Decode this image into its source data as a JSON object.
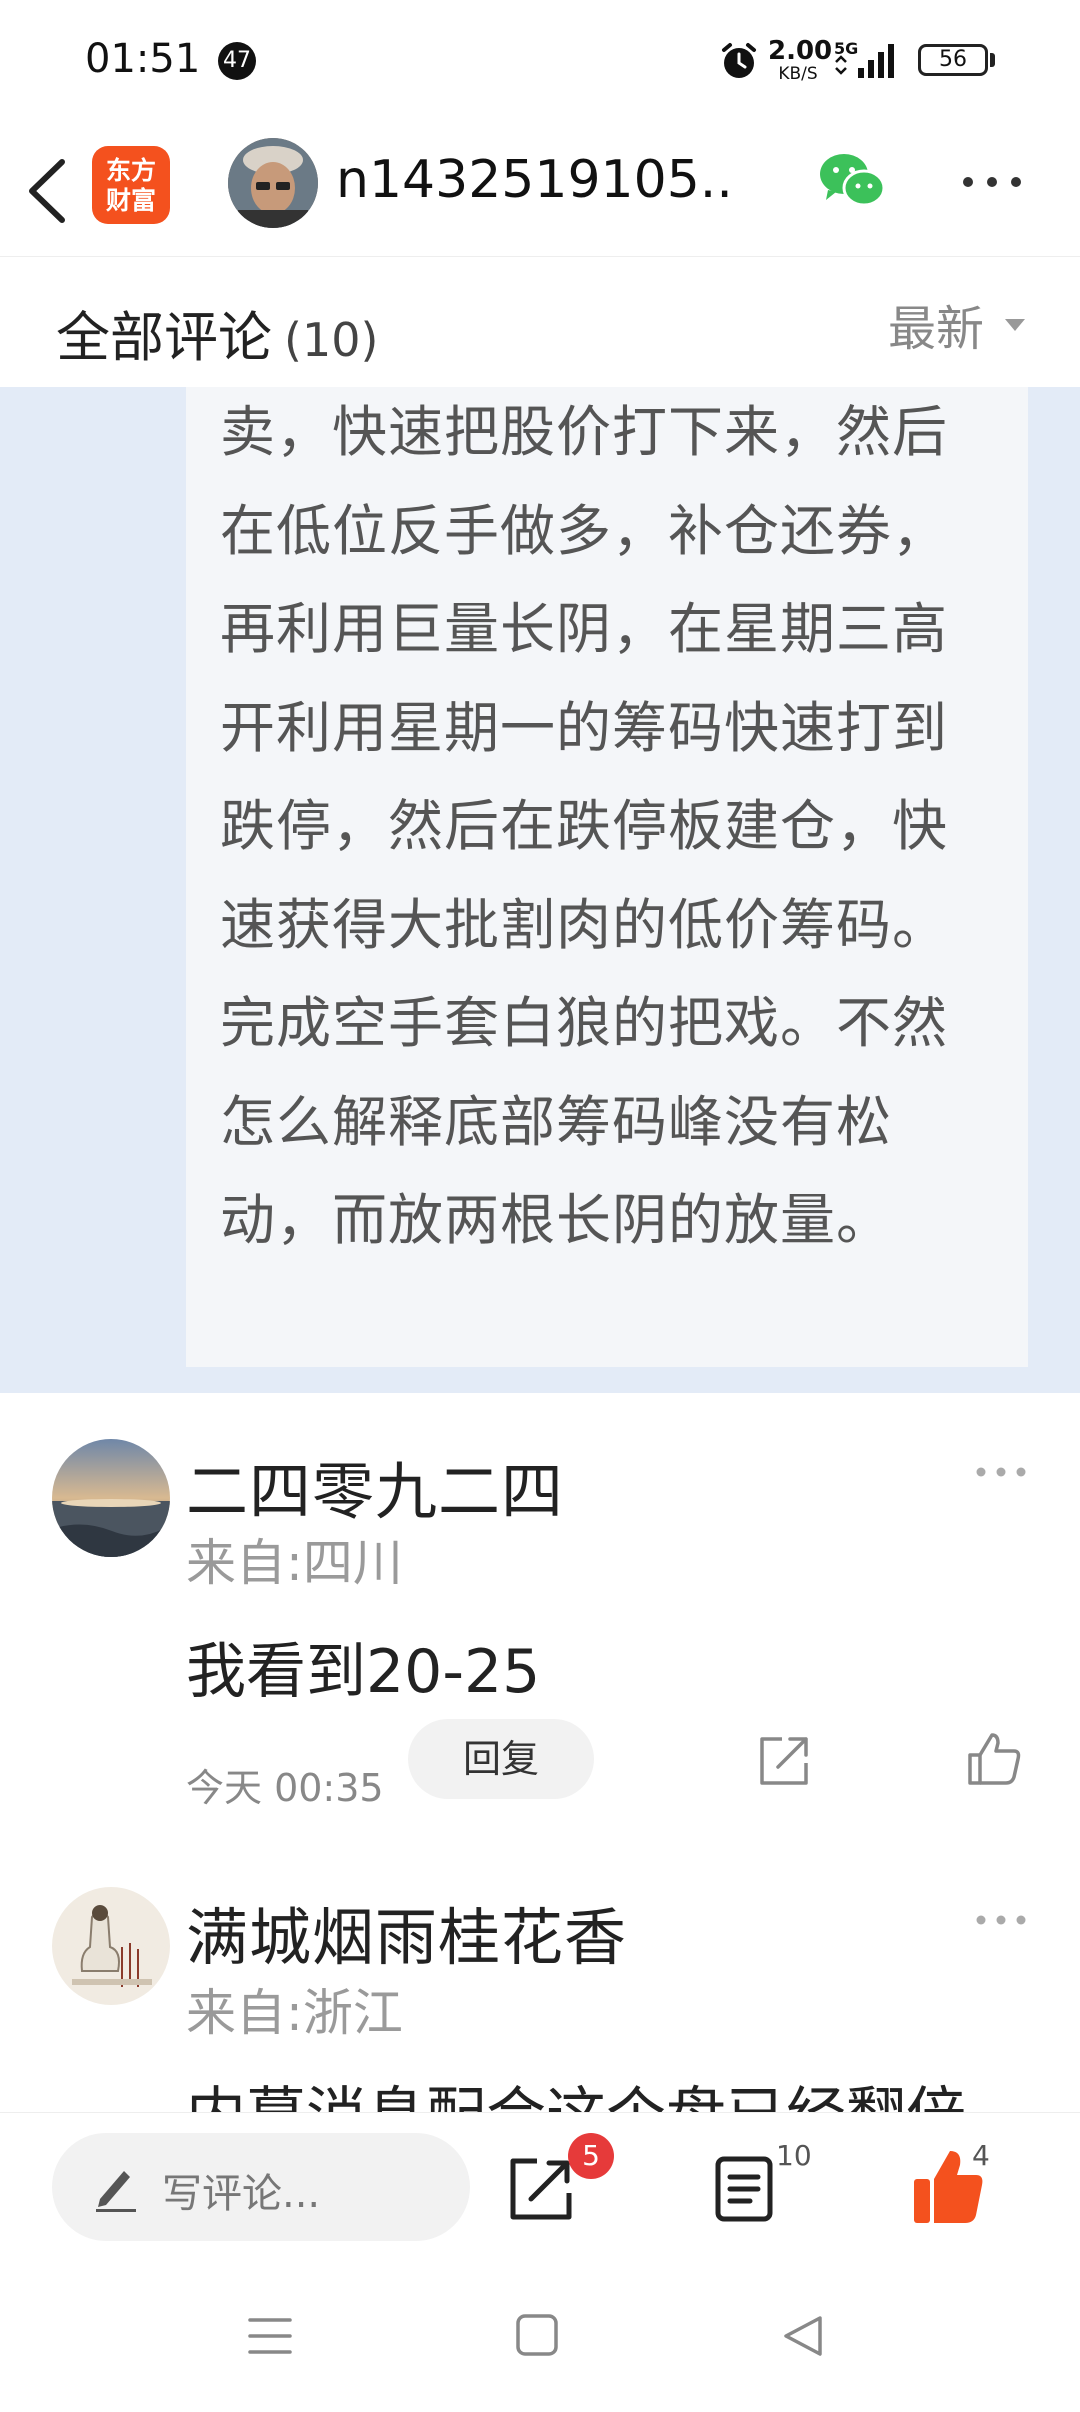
{
  "status_bar": {
    "time": "01:51",
    "notification_count": "47",
    "net_speed_value": "2.00",
    "net_speed_unit": "KB/S",
    "network_type": "5G",
    "battery": "56"
  },
  "header": {
    "app_logo_line1": "东方",
    "app_logo_line2": "财富",
    "username": "n1432519105...",
    "icons": [
      "back-icon",
      "wechat-icon",
      "more-icon"
    ]
  },
  "comments_header": {
    "title": "全部评论",
    "count": "(10)",
    "sort": "最新"
  },
  "quoted_post": {
    "text": "卖，快速把股价打下来，然后在低位反手做多，补仓还券，再利用巨量长阴，在星期三高开利用星期一的筹码快速打到跌停，然后在跌停板建仓，快速获得大批割肉的低价筹码。完成空手套白狼的把戏。不然怎么解释底部筹码峰没有松动，而放两根长阴的放量。"
  },
  "comments": [
    {
      "name": "二四零九二四",
      "location": "来自:四川",
      "body": "我看到20-25",
      "time": "今天 00:35",
      "reply_label": "回复"
    },
    {
      "name": "满城烟雨桂花香",
      "location": "来自:浙江",
      "body": "内幕消息配合这个盘已经翻倍"
    }
  ],
  "bottom_bar": {
    "write_placeholder": "写评论...",
    "share_badge": "5",
    "comment_count": "10",
    "like_count": "4",
    "accent_color": "#f4511e"
  }
}
